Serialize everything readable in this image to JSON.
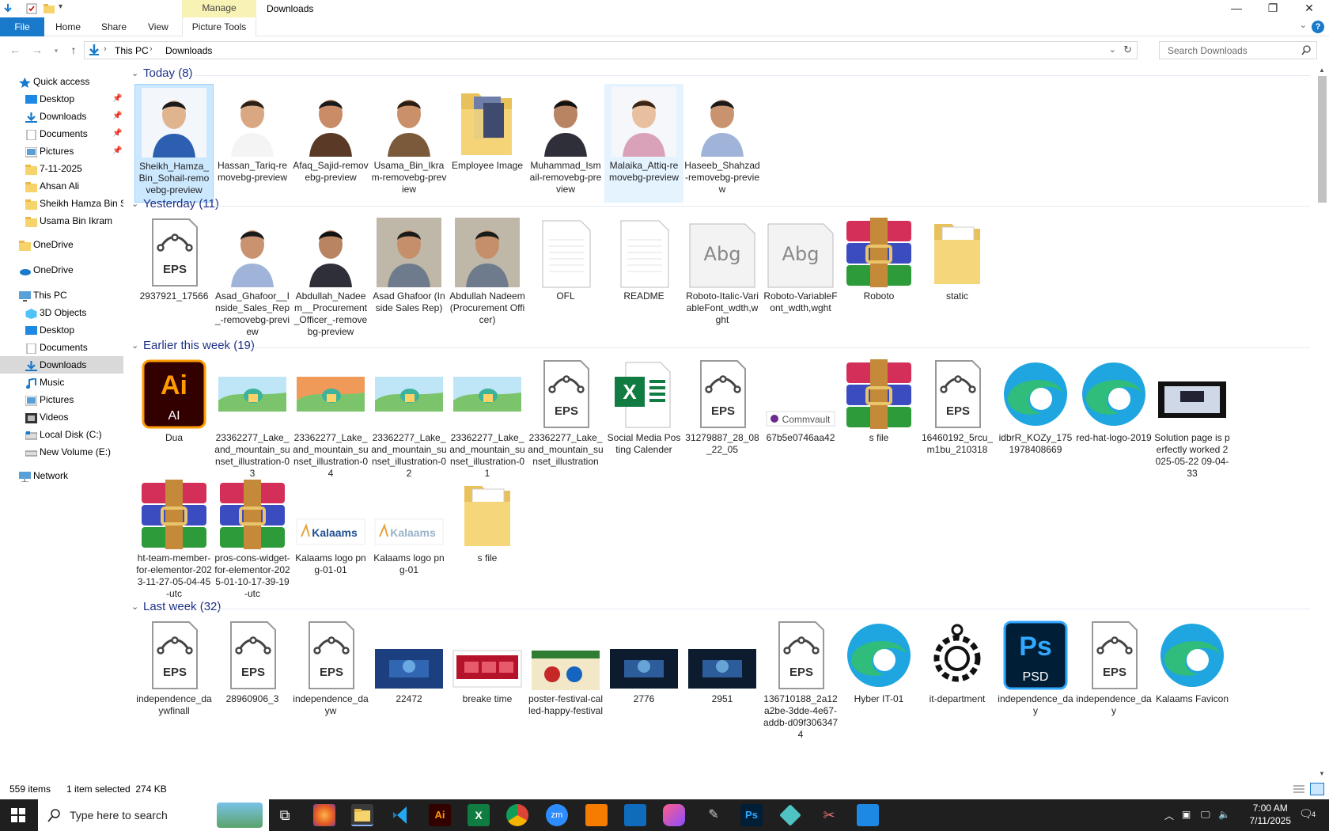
{
  "window": {
    "title": "Downloads",
    "manage_tab": "Manage",
    "minimize": "—",
    "restore": "❐",
    "close": "✕"
  },
  "ribbon": {
    "tabs": [
      "File",
      "Home",
      "Share",
      "View",
      "Picture Tools"
    ],
    "help": "?",
    "expand": "⌄"
  },
  "address": {
    "crumbs": [
      "This PC",
      "Downloads"
    ],
    "search_placeholder": "Search Downloads"
  },
  "nav": {
    "quick_access": "Quick access",
    "items": [
      "Desktop",
      "Downloads",
      "Documents",
      "Pictures",
      "7-11-2025",
      "Ahsan Ali",
      "Sheikh Hamza Bin S",
      "Usama Bin Ikram"
    ],
    "onedrive1": "OneDrive",
    "onedrive2": "OneDrive",
    "this_pc": "This PC",
    "pc_items": [
      "3D Objects",
      "Desktop",
      "Documents",
      "Downloads",
      "Music",
      "Pictures",
      "Videos",
      "Local Disk (C:)",
      "New Volume (E:)"
    ],
    "network": "Network"
  },
  "groups": [
    {
      "title": "Today (8)",
      "items": [
        {
          "name": "Sheikh_Hamza_Bin_Sohail-removebg-preview",
          "kind": "photo-blue"
        },
        {
          "name": "Hassan_Tariq-removebg-preview",
          "kind": "photo-white"
        },
        {
          "name": "Afaq_Sajid-removebg-preview",
          "kind": "photo-brown"
        },
        {
          "name": "Usama_Bin_Ikram-removebg-preview",
          "kind": "photo-suit"
        },
        {
          "name": "Employee Image",
          "kind": "folder-img"
        },
        {
          "name": "Muhammad_Ismail-removebg-preview",
          "kind": "photo-dark"
        },
        {
          "name": "Malaika_Attiq-removebg-preview",
          "kind": "photo-girl"
        },
        {
          "name": "Haseeb_Shahzad-removebg-preview",
          "kind": "photo-check"
        }
      ]
    },
    {
      "title": "Yesterday (11)",
      "items": [
        {
          "name": "2937921_17566",
          "kind": "eps"
        },
        {
          "name": "Asad_Ghafoor__Inside_Sales_Rep_-removebg-preview",
          "kind": "photo-check"
        },
        {
          "name": "Abdullah_Nadeem__Procurement_Officer_-removebg-preview",
          "kind": "photo-dark"
        },
        {
          "name": "Asad Ghafoor (Inside Sales Rep)",
          "kind": "photo-bg"
        },
        {
          "name": "Abdullah Nadeem (Procurement Officer)",
          "kind": "photo-bg"
        },
        {
          "name": "OFL",
          "kind": "doc"
        },
        {
          "name": "README",
          "kind": "doc"
        },
        {
          "name": "Roboto-Italic-VariableFont_wdth,wght",
          "kind": "font"
        },
        {
          "name": "Roboto-VariableFont_wdth,wght",
          "kind": "font"
        },
        {
          "name": "Roboto",
          "kind": "rar"
        },
        {
          "name": "static",
          "kind": "folder-doc"
        }
      ]
    },
    {
      "title": "Earlier this week (19)",
      "items": [
        {
          "name": "Dua",
          "kind": "ai"
        },
        {
          "name": "23362277_Lake_and_mountain_sunset_illustration-03",
          "kind": "land"
        },
        {
          "name": "23362277_Lake_and_mountain_sunset_illustration-04",
          "kind": "land-dark"
        },
        {
          "name": "23362277_Lake_and_mountain_sunset_illustration-02",
          "kind": "land"
        },
        {
          "name": "23362277_Lake_and_mountain_sunset_illustration-01",
          "kind": "land"
        },
        {
          "name": "23362277_Lake_and_mountain_sunset_illustration",
          "kind": "eps"
        },
        {
          "name": "Social Media Posting Calender",
          "kind": "excel"
        },
        {
          "name": "31279887_28_08_22_05",
          "kind": "eps"
        },
        {
          "name": "67b5e0746aa42",
          "kind": "commvault"
        },
        {
          "name": "s file",
          "kind": "rar"
        },
        {
          "name": "16460192_5rcu_m1bu_210318",
          "kind": "eps"
        },
        {
          "name": "idbrR_KOZy_1751978408669",
          "kind": "edge"
        },
        {
          "name": "red-hat-logo-2019",
          "kind": "edge"
        },
        {
          "name": "Solution page is perfectly worked 2025-05-22 09-04-33",
          "kind": "video"
        },
        {
          "name": "ht-team-member-for-elementor-2023-11-27-05-04-45-utc",
          "kind": "rar"
        },
        {
          "name": "pros-cons-widget-for-elementor-2025-01-10-17-39-19-utc",
          "kind": "rar"
        },
        {
          "name": "Kalaams logo png-01-01",
          "kind": "kalaams"
        },
        {
          "name": "Kalaams logo png-01",
          "kind": "kalaams-light"
        },
        {
          "name": "s file",
          "kind": "folder-doc"
        }
      ]
    },
    {
      "title": "Last week (32)",
      "items": [
        {
          "name": "independence_daywfinall",
          "kind": "eps"
        },
        {
          "name": "28960906_3",
          "kind": "eps"
        },
        {
          "name": "independence_dayw",
          "kind": "eps"
        },
        {
          "name": "22472",
          "kind": "tech"
        },
        {
          "name": "breake time",
          "kind": "web"
        },
        {
          "name": "poster-festival-called-happy-festival",
          "kind": "poster"
        },
        {
          "name": "2776",
          "kind": "tech-dark"
        },
        {
          "name": "2951",
          "kind": "tech-dark"
        },
        {
          "name": "136710188_2a12a2be-3dde-4e67-addb-d09f3063474",
          "kind": "eps"
        },
        {
          "name": "Hyber IT-01",
          "kind": "edge"
        },
        {
          "name": "it-department",
          "kind": "gear"
        },
        {
          "name": "independence_day",
          "kind": "psd"
        },
        {
          "name": "independence_day",
          "kind": "eps"
        },
        {
          "name": "Kalaams Favicon",
          "kind": "edge"
        }
      ]
    }
  ],
  "status": {
    "count": "559 items",
    "selected": "1 item selected  274 KB"
  },
  "taskbar": {
    "search_placeholder": "Type here to search",
    "time": "7:00 AM",
    "date": "7/11/2025",
    "notif_count": "4"
  },
  "colors": {
    "accent": "#1979ca",
    "selection": "#cce8ff",
    "group_title": "#1e3287"
  }
}
